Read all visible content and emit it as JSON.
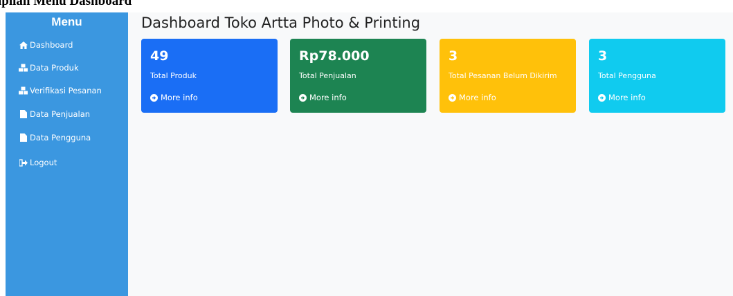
{
  "document": {
    "caption": "Tampilan Menu Dashboard"
  },
  "sidebar": {
    "title": "Menu",
    "items": [
      {
        "label": "Dashboard",
        "icon": "home-icon"
      },
      {
        "label": "Data Produk",
        "icon": "cubes-icon"
      },
      {
        "label": "Verifikasi Pesanan",
        "icon": "cubes-icon"
      },
      {
        "label": "Data Penjualan",
        "icon": "file-icon"
      },
      {
        "label": "Data Pengguna",
        "icon": "file-icon"
      },
      {
        "label": "Logout",
        "icon": "sign-out-icon"
      }
    ],
    "color": "#3b97e0"
  },
  "main": {
    "title": "Dashboard Toko Artta Photo & Printing",
    "cards": [
      {
        "value": "49",
        "label": "Total Produk",
        "link": "More info",
        "color": "#1a6ef5"
      },
      {
        "value": "Rp78.000",
        "label": "Total Penjualan",
        "link": "More info",
        "color": "#1d8452"
      },
      {
        "value": "3",
        "label": "Total Pesanan Belum Dikirim",
        "link": "More info",
        "color": "#ffc10a"
      },
      {
        "value": "3",
        "label": "Total Pengguna",
        "link": "More info",
        "color": "#10cbef"
      }
    ]
  }
}
